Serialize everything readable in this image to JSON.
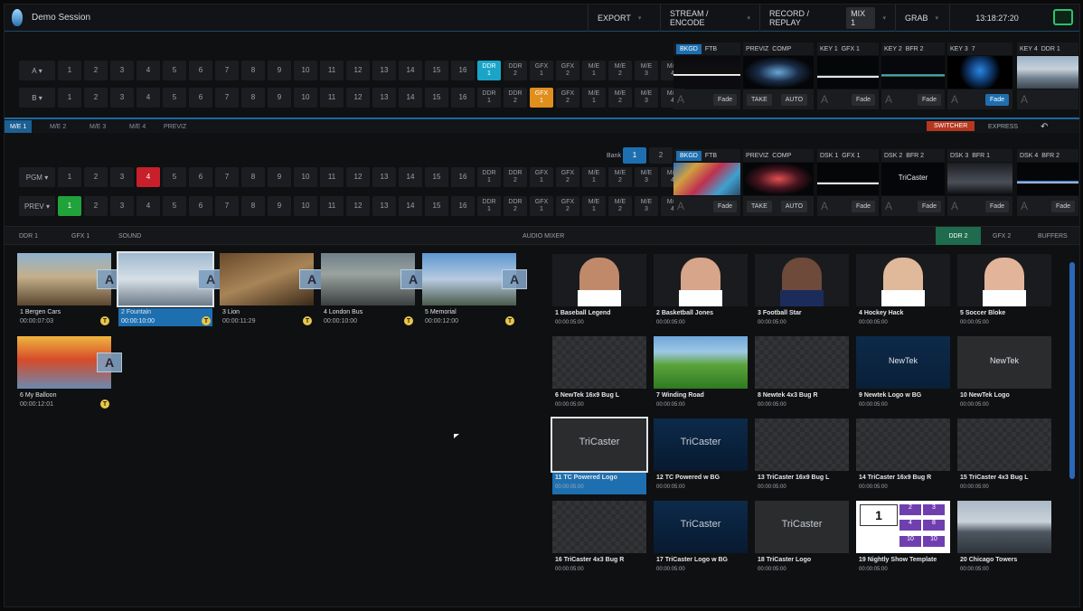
{
  "title_bar": {
    "session_name": "Demo Session",
    "menus": [
      {
        "label": "EXPORT"
      },
      {
        "label": "STREAM / ENCODE"
      },
      {
        "label": "RECORD / REPLAY"
      },
      {
        "label": "GRAB"
      }
    ],
    "mix_tag": "MIX 1",
    "clock": "13:18:27:20"
  },
  "top_switcher": {
    "row_a_label": "A",
    "row_b_label": "B",
    "numbers": [
      "1",
      "2",
      "3",
      "4",
      "5",
      "6",
      "7",
      "8",
      "9",
      "10",
      "11",
      "12",
      "13",
      "14",
      "15",
      "16"
    ],
    "special": [
      {
        "top": "DDR",
        "bot": "1"
      },
      {
        "top": "DDR",
        "bot": "2"
      },
      {
        "top": "GFX",
        "bot": "1"
      },
      {
        "top": "GFX",
        "bot": "2"
      },
      {
        "top": "M/E",
        "bot": "1"
      },
      {
        "top": "M/E",
        "bot": "2"
      },
      {
        "top": "M/E",
        "bot": "3"
      },
      {
        "top": "M/E",
        "bot": "4"
      }
    ],
    "a_selected_special": "DDR 1",
    "b_selected_special": "GFX 1",
    "panels": [
      {
        "label": "BKGD",
        "sub": "FTB",
        "button": "Fade"
      },
      {
        "label": "PREVIZ",
        "sub": "COMP",
        "take": "TAKE",
        "auto": "AUTO"
      },
      {
        "label": "KEY 1",
        "sub": "GFX 1",
        "button": "Fade"
      },
      {
        "label": "KEY 2",
        "sub": "BFR 2",
        "button": "Fade"
      },
      {
        "label": "KEY 3",
        "sub": "7",
        "button": "Fade"
      },
      {
        "label": "KEY 4",
        "sub": "DDR 1",
        "button": ""
      }
    ]
  },
  "me_tabs": {
    "tabs": [
      "M/E 1",
      "M/E 2",
      "M/E 3",
      "M/E 4",
      "PREVIZ"
    ],
    "selected": "M/E 1",
    "switcher_btn": "SWITCHER",
    "express_btn": "EXPRESS",
    "back_icon": "undo-icon"
  },
  "main_switcher": {
    "bank_label": "Bank",
    "bank_1": "1",
    "bank_2": "2",
    "pgm_label": "PGM",
    "prev_label": "PREV",
    "numbers": [
      "1",
      "2",
      "3",
      "4",
      "5",
      "6",
      "7",
      "8",
      "9",
      "10",
      "11",
      "12",
      "13",
      "14",
      "15",
      "16"
    ],
    "pgm_selected": "4",
    "prev_selected": "1",
    "special": [
      {
        "top": "DDR",
        "bot": "1"
      },
      {
        "top": "DDR",
        "bot": "2"
      },
      {
        "top": "GFX",
        "bot": "1"
      },
      {
        "top": "GFX",
        "bot": "2"
      },
      {
        "top": "M/E",
        "bot": "1"
      },
      {
        "top": "M/E",
        "bot": "2"
      },
      {
        "top": "M/E",
        "bot": "3"
      },
      {
        "top": "M/E",
        "bot": "4"
      }
    ],
    "panels": [
      {
        "label": "BKGD",
        "sub": "FTB",
        "button": "Fade"
      },
      {
        "label": "PREVIZ",
        "sub": "COMP",
        "take": "TAKE",
        "auto": "AUTO"
      },
      {
        "label": "DSK 1",
        "sub": "GFX 1",
        "button": "Fade"
      },
      {
        "label": "DSK 2",
        "sub": "BFR 2",
        "button": "Fade",
        "logo": "TriCaster"
      },
      {
        "label": "DSK 3",
        "sub": "BFR 1",
        "button": "Fade"
      },
      {
        "label": "DSK 4",
        "sub": "BFR 2",
        "button": "Fade"
      }
    ]
  },
  "bottom_tabs": {
    "left": [
      "DDR 1",
      "GFX 1",
      "SOUND"
    ],
    "center": "AUDIO MIXER",
    "right": [
      "DDR 2",
      "GFX 2",
      "BUFFERS"
    ],
    "selected": "DDR 2"
  },
  "ddr1_clips": [
    {
      "name": "1 Bergen Cars",
      "time": "00:00:07:03"
    },
    {
      "name": "2 Fountain",
      "time": "00:00:10:00",
      "selected": true
    },
    {
      "name": "3 Lion",
      "time": "00:00:11:29"
    },
    {
      "name": "4 London Bus",
      "time": "00:00:10:00"
    },
    {
      "name": "5 Memorial",
      "time": "00:00:12:00"
    },
    {
      "name": "6 My Balloon",
      "time": "00:00:12:01"
    }
  ],
  "clip_badge": "A",
  "clip_t_icon": "T",
  "ddr2_clips": [
    {
      "name": "1 Baseball Legend",
      "time": "00:00:05:00"
    },
    {
      "name": "2 Basketball Jones",
      "time": "00:00:05:00"
    },
    {
      "name": "3 Football Star",
      "time": "00:00:05:00"
    },
    {
      "name": "4 Hockey Hack",
      "time": "00:00:05:00"
    },
    {
      "name": "5 Soccer Bloke",
      "time": "00:00:05:00"
    },
    {
      "name": "6 NewTek 16x9 Bug L",
      "time": "00:00:05:00"
    },
    {
      "name": "7 Winding Road",
      "time": "00:00:05:00"
    },
    {
      "name": "8 Newtek 4x3 Bug R",
      "time": "00:00:05:00"
    },
    {
      "name": "9 Newtek Logo w BG",
      "time": "00:00:05:00"
    },
    {
      "name": "10 NewTek Logo",
      "time": "00:00:05:00"
    },
    {
      "name": "11 TC Powered Logo",
      "time": "00:00:05:00",
      "selected": true
    },
    {
      "name": "12 TC Powered w BG",
      "time": "00:00:05:00"
    },
    {
      "name": "13 TriCaster 16x9 Bug L",
      "time": "00:00:05:00"
    },
    {
      "name": "14 TriCaster 16x9 Bug R",
      "time": "00:00:05:00"
    },
    {
      "name": "15 TriCaster 4x3 Bug L",
      "time": "00:00:05:00"
    },
    {
      "name": "16 TriCaster 4x3 Bug R",
      "time": "00:00:05:00"
    },
    {
      "name": "17 TriCaster Logo w BG",
      "time": "00:00:05:00"
    },
    {
      "name": "18 TriCaster Logo",
      "time": "00:00:05:00"
    },
    {
      "name": "19 Nightly Show Template",
      "time": "00:00:05:00"
    },
    {
      "name": "20 Chicago Towers",
      "time": "00:00:05:00"
    }
  ],
  "thumb_text": {
    "newtek": "NewTek",
    "tricaster": "TriCaster",
    "scoreboard": [
      "1",
      "2",
      "3",
      "4",
      "8",
      "10",
      "10"
    ]
  }
}
